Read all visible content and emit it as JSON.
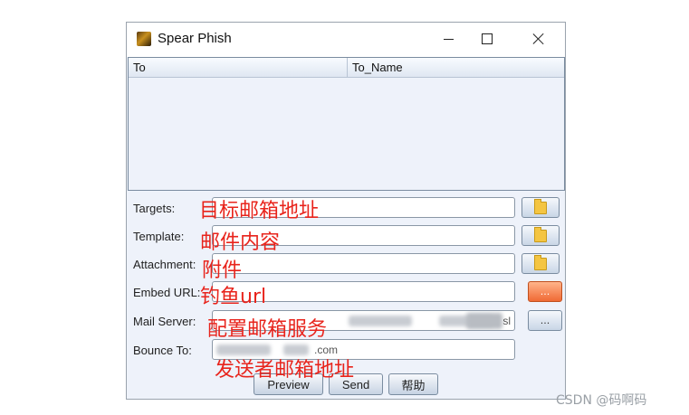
{
  "window": {
    "title": "Spear Phish",
    "controls": {
      "minimize": "minimize",
      "maximize": "maximize",
      "close": "close"
    }
  },
  "table": {
    "columns": [
      "To",
      "To_Name"
    ],
    "rows": []
  },
  "form": {
    "targets": {
      "label": "Targets:",
      "value": "",
      "annotation": "目标邮箱地址"
    },
    "template": {
      "label": "Template:",
      "value": "",
      "annotation": "邮件内容"
    },
    "attachment": {
      "label": "Attachment:",
      "value": "",
      "annotation": "附件"
    },
    "embed_url": {
      "label": "Embed URL:",
      "value": "",
      "button_label": "...",
      "annotation": "钓鱼url"
    },
    "mail_server": {
      "label": "Mail Server:",
      "value_tail": "sl",
      "button_label": "...",
      "annotation": "配置邮箱服务"
    },
    "bounce_to": {
      "label": "Bounce To:",
      "value_tail": ".com",
      "annotation": "发送者邮箱地址"
    }
  },
  "buttons": {
    "preview": "Preview",
    "send": "Send",
    "help": "帮助"
  },
  "watermark": "CSDN @码啊码",
  "colors": {
    "annotation": "#e8241c",
    "orange_button": "#f06a35",
    "window_bg": "#eef2fa"
  }
}
